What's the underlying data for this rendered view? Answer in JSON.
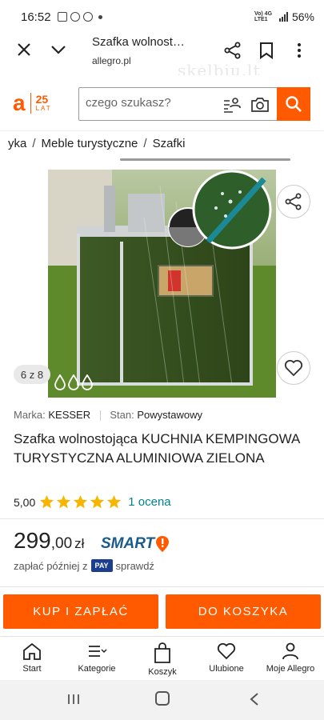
{
  "status_bar": {
    "time": "16:52",
    "network": "Vo) 4G LTE1",
    "battery": "56%"
  },
  "browser": {
    "page_title": "Szafka wolnost…",
    "url": "allegro.pl",
    "watermark": "skelbiu.lt"
  },
  "header": {
    "logo_letter": "a",
    "logo_years": "25",
    "logo_lat": "LAT",
    "search_placeholder": "czego szukasz?"
  },
  "breadcrumb": [
    "yka",
    "Meble turystyczne",
    "Szafki"
  ],
  "gallery": {
    "counter": "6 z 8"
  },
  "product": {
    "brand_label": "Marka:",
    "brand": "KESSER",
    "condition_label": "Stan:",
    "condition": "Powystawowy",
    "title": "Szafka wolnostojąca KUCHNIA KEMPINGOWA TURYSTYCZNA ALUMINIOWA ZIELONA",
    "rating_value": "5,00",
    "rating_stars": 5,
    "rating_count": "1 ocena",
    "price_main": "299",
    "price_cents": ",00",
    "currency": "zł",
    "smart_label": "SMART",
    "pay_text_before": "zapłać później z",
    "pay_badge": "PAY",
    "pay_text_after": "sprawdź"
  },
  "actions": {
    "buy": "KUP I ZAPŁAĆ",
    "cart": "DO KOSZYKA"
  },
  "bottom_nav": [
    {
      "label": "Start",
      "icon": "home-icon"
    },
    {
      "label": "Kategorie",
      "icon": "menu-icon"
    },
    {
      "label": "Koszyk",
      "icon": "bag-icon"
    },
    {
      "label": "Ulubione",
      "icon": "heart-icon"
    },
    {
      "label": "Moje Allegro",
      "icon": "user-icon"
    }
  ],
  "colors": {
    "accent": "#ff5a00",
    "link": "#00838f",
    "star": "#f7b500",
    "smart": "#1a5b8c"
  }
}
